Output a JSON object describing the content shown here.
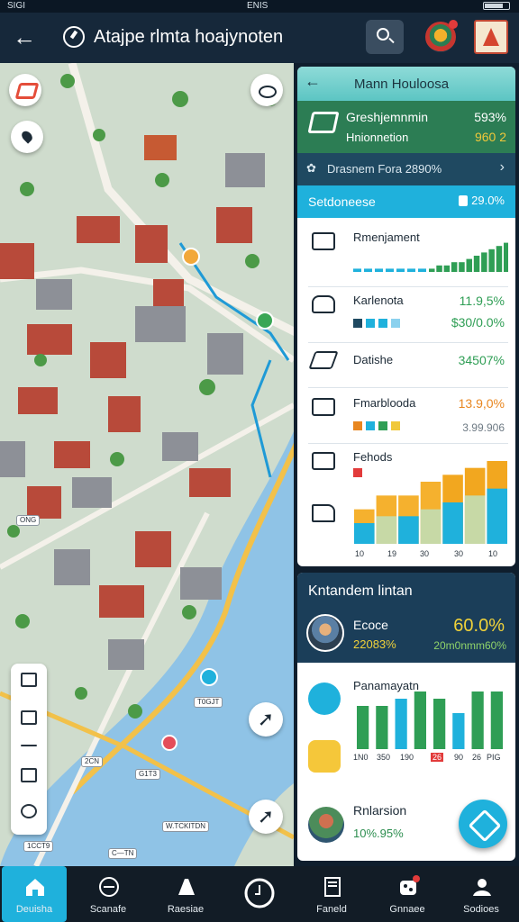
{
  "status": {
    "left": "SIGI",
    "center": "ENIS"
  },
  "appbar": {
    "title": "Atajpe rlmta hoajynoten"
  },
  "map": {
    "labels": [
      "ONG",
      "T0GJT",
      "2CN",
      "W.TCKITDN",
      "C—TN",
      "1CCT9",
      "G1T3"
    ]
  },
  "panel": {
    "header": "Mann Houloosa",
    "summary": {
      "title": "Greshjemnmin",
      "subtitle": "Hnionnetion",
      "value": "593%",
      "value2": "960 2"
    },
    "filter": "Drasnem Fora 2890%",
    "subheader": {
      "title": "Setdoneese",
      "pill": "29.0%"
    },
    "rows": [
      {
        "name": "Rmenjament",
        "value": "",
        "color": "#2f9e55"
      },
      {
        "name": "Karlenota",
        "value": "11.9,5%",
        "value2": "$30/0.0%",
        "color": "#2f9e55"
      },
      {
        "name": "Datishe",
        "value": "34507%",
        "color": "#2f9e55"
      },
      {
        "name": "Fmarblooda",
        "value": "13.9,0%",
        "value2": "3.99.906",
        "color": "#e8861f"
      },
      {
        "name": "Fehods",
        "value": "",
        "color": "#e8861f"
      }
    ],
    "ticks": [
      "10",
      "19",
      "30",
      "30",
      "10"
    ]
  },
  "panel2": {
    "title": "Kntandem lintan",
    "top": {
      "name": "Ecoce",
      "sub": "22083%",
      "value": "60.0%",
      "value2": "20m0nmm60%"
    },
    "chart_name": "Panamayatn",
    "ticks": [
      "1N0",
      "350",
      "190",
      "26",
      "90",
      "26",
      "PIG"
    ],
    "bottom": {
      "name": "Rnlarsion",
      "sub": "10%.95%"
    }
  },
  "nav": [
    {
      "label": "Deuisha"
    },
    {
      "label": "Scanafe"
    },
    {
      "label": "Raesiae"
    },
    {
      "label": ""
    },
    {
      "label": "Faneld"
    },
    {
      "label": "Gnnaee"
    },
    {
      "label": "Sodioes"
    }
  ],
  "chart_data": [
    {
      "type": "bar",
      "title": "Rmenjament",
      "series": [
        {
          "values": [
            1,
            1,
            1,
            1,
            1,
            1,
            1
          ]
        },
        {
          "values": [
            1,
            2,
            2,
            3,
            3,
            4,
            5,
            6,
            7,
            8,
            9,
            9
          ]
        }
      ]
    },
    {
      "type": "bar",
      "title": "Fehods",
      "series": [
        {
          "values": [
            3,
            4,
            4,
            5,
            6,
            7,
            8
          ]
        },
        {
          "values": [
            5,
            7,
            7,
            9,
            10,
            11,
            12
          ]
        }
      ]
    },
    {
      "type": "bar",
      "title": "Panamayatn",
      "categories": [
        "1N0",
        "350",
        "190",
        "26",
        "90",
        "26",
        "PIG"
      ],
      "values": [
        6,
        6,
        7,
        8,
        7,
        5,
        8,
        8
      ]
    }
  ]
}
